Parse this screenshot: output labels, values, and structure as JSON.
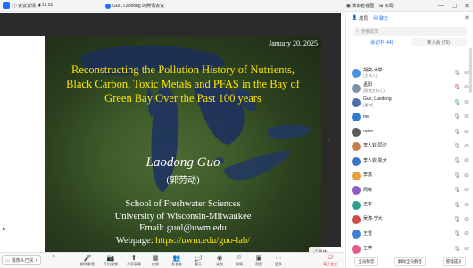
{
  "topbar": {
    "app_label": "会议详情",
    "timer": "12:51",
    "network_label": "•",
    "meeting_title": "Guo, Laodong 的腾讯会议",
    "speaker_view": "演讲者视图",
    "layout_label": "布局",
    "window_controls": [
      "—",
      "☐",
      "✕"
    ]
  },
  "slide": {
    "date": "January 20, 2025",
    "title_lines": [
      "Reconstructing the Pollution History of Nutrients,",
      "Black Carbon, Toxic Metals and PFAS in the Bay of",
      "Green Bay Over the Past 100 years"
    ],
    "speaker": "Laodong Guo",
    "speaker_cn": "(郭劳动)",
    "info_lines": [
      "School of Freshwater Sciences",
      "University of Wisconsin-Milwaukee",
      "Email: guol@uwm.edu"
    ],
    "webpage_prefix": "Webpage: ",
    "webpage_link": "https://uwm.edu/guo-lab/"
  },
  "zoom_badge": "最佳",
  "toolbar": {
    "camera_pill": "摄像头已关",
    "buttons": [
      {
        "label": "解除静音",
        "icon": "🎤"
      },
      {
        "label": "开启视频",
        "icon": "📷"
      },
      {
        "label": "共享屏幕",
        "icon": "⬆"
      },
      {
        "label": "应用",
        "icon": "▦"
      },
      {
        "label": "参会者",
        "icon": "👥"
      },
      {
        "label": "聊天",
        "icon": "💬"
      },
      {
        "label": "录制",
        "icon": "◉"
      },
      {
        "label": "表情",
        "icon": "☺"
      },
      {
        "label": "视图",
        "icon": "▣"
      },
      {
        "label": "更多",
        "icon": "⋯"
      }
    ],
    "leave_label": "离开会议"
  },
  "panel": {
    "tabs": [
      "成员",
      "聊天"
    ],
    "search_placeholder": "搜索成员",
    "segments": [
      "会议中 (44)",
      "未入会 (25)"
    ],
    "participants": [
      {
        "name": "胡奕-大学",
        "sub": "(主持人)",
        "color": "#4a90e2",
        "icons": [
          "mic-off",
          "cam-off"
        ]
      },
      {
        "name": "孟阳",
        "sub": "(联席主持人)",
        "color": "#7b8fa6",
        "icons": [
          "mic-red",
          "cam-off"
        ]
      },
      {
        "name": "Guo, Laodong",
        "sub": "(嘉宾)",
        "color": "#4a6fa5",
        "icons": [
          "mic-green",
          "cam-off"
        ]
      },
      {
        "name": "me",
        "sub": "",
        "color": "#2e7dd1",
        "icons": [
          "mic-off",
          "cam-off"
        ]
      },
      {
        "name": "ruber",
        "sub": "",
        "color": "#5b5b5b",
        "icons": [
          "mic-off",
          "cam-off"
        ]
      },
      {
        "name": "李人钦-同济",
        "sub": "",
        "color": "#c77d4a",
        "icons": [
          "mic-off",
          "cam-off"
        ]
      },
      {
        "name": "李人钦-浙大",
        "sub": "",
        "color": "#3b78c4",
        "icons": [
          "mic-off",
          "cam-off"
        ]
      },
      {
        "name": "李鑫",
        "sub": "",
        "color": "#e6a23c",
        "icons": [
          "mic-off",
          "cam-off"
        ]
      },
      {
        "name": "周敏",
        "sub": "",
        "color": "#8e5cc4",
        "icons": [
          "mic-off",
          "cam-off"
        ]
      },
      {
        "name": "王宇",
        "sub": "",
        "color": "#2f9e8f",
        "icons": [
          "mic-off",
          "cam-off"
        ]
      },
      {
        "name": "吴涛-宁大",
        "sub": "",
        "color": "#d14b4b",
        "icons": [
          "mic-off",
          "cam-off"
        ]
      },
      {
        "name": "王雪",
        "sub": "",
        "color": "#3f7fd6",
        "icons": [
          "mic-off",
          "cam-off"
        ]
      },
      {
        "name": "王婷",
        "sub": "",
        "color": "#e05b8b",
        "icons": [
          "mic-off",
          "cam-off"
        ]
      }
    ],
    "bottom_buttons": [
      "全员静音",
      "解除全员静音",
      "管理成员"
    ]
  }
}
